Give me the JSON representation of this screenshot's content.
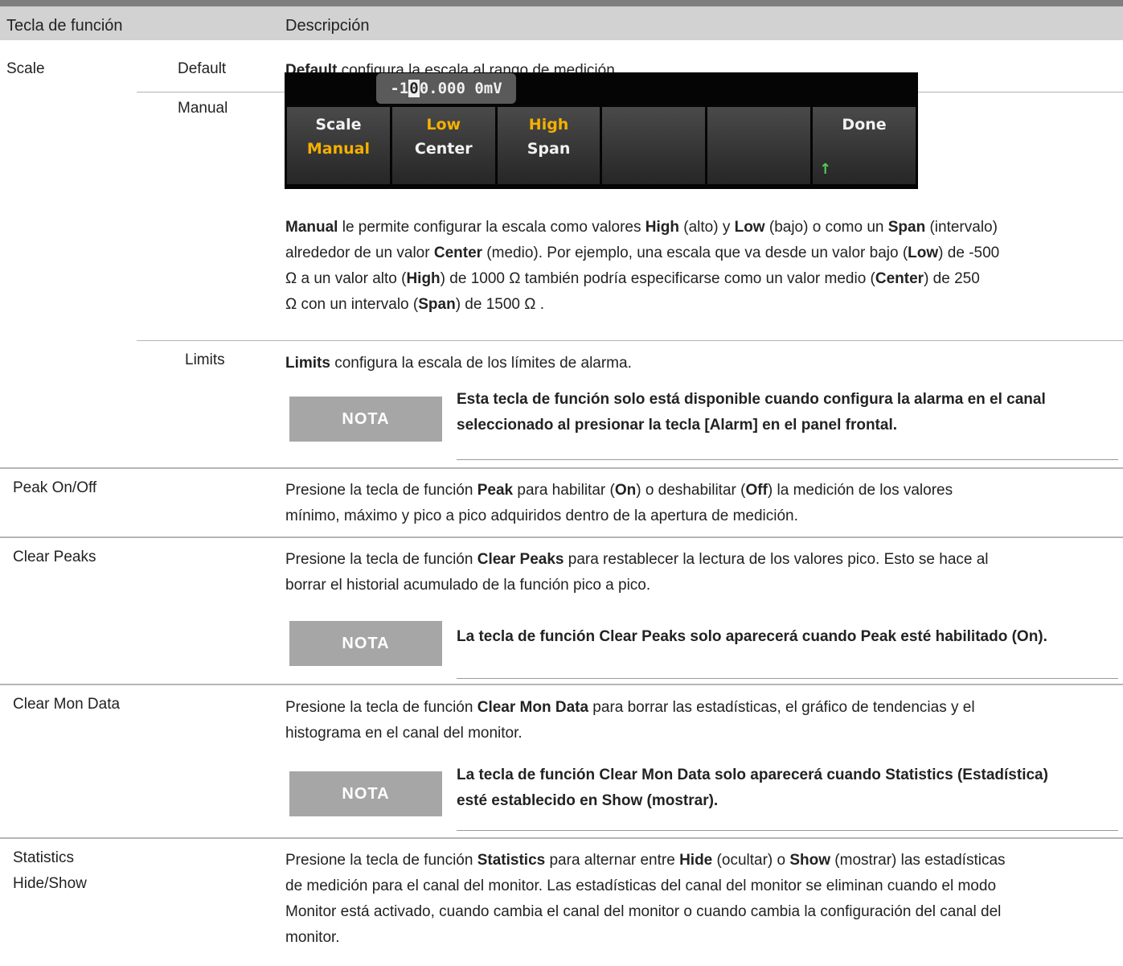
{
  "header": {
    "col1": "Tecla de función",
    "col2": "Descripción"
  },
  "scale": {
    "label": "Scale",
    "default": {
      "label": "Default",
      "bold": "Default",
      "text": " configura la escala al rango de medición."
    },
    "manual": {
      "label": "Manual",
      "screen": {
        "entry_pre": "-1",
        "entry_cursor": "0",
        "entry_post": "0.000 0mV",
        "softkeys": [
          {
            "line1": "Scale",
            "line2": "Manual"
          },
          {
            "line1": "Low",
            "line2": "Center"
          },
          {
            "line1": "High",
            "line2": "Span"
          },
          {
            "line1": "",
            "line2": ""
          },
          {
            "line1": "",
            "line2": ""
          },
          {
            "line1": "Done",
            "line2": "↑"
          }
        ]
      },
      "p": [
        "Manual",
        " le permite configurar la escala como valores ",
        "High",
        " (alto) y ",
        "Low",
        " (bajo) o como un ",
        "Span",
        " (intervalo)",
        "alrededor de un valor ",
        "Center",
        " (medio). Por ejemplo, una escala que va desde un valor bajo (",
        "Low",
        ") de -500",
        "Ω  a un valor alto (",
        "High",
        ") de 1000 Ω  también podría especificarse como un valor medio (",
        "Center",
        ") de 250",
        "Ω  con un intervalo (",
        "Span",
        ") de 1500 Ω ."
      ]
    },
    "limits": {
      "label": "Limits",
      "bold": "Limits",
      "text": " configura la escala de los límites de alarma.",
      "nota": "NOTA",
      "note_l1": "Esta tecla de función solo está disponible cuando configura la alarma en el canal",
      "note_l2": "seleccionado al presionar la tecla [Alarm] en el panel frontal."
    }
  },
  "peak": {
    "label": "Peak On/Off",
    "p": [
      "Presione la tecla de función ",
      "Peak",
      " para habilitar (",
      "On",
      ") o deshabilitar (",
      "Off",
      ") la medición de los valores",
      "mínimo, máximo y pico a pico adquiridos dentro de la apertura de medición."
    ]
  },
  "clear_peaks": {
    "label": "Clear Peaks",
    "p": [
      "Presione la tecla de función ",
      "Clear Peaks",
      " para restablecer la lectura de los valores pico. Esto se hace al",
      "borrar el historial acumulado de la función pico a pico."
    ],
    "nota": "NOTA",
    "note": "La tecla de función Clear Peaks solo aparecerá cuando Peak esté habilitado (On)."
  },
  "clear_mon": {
    "label": "Clear Mon Data",
    "p": [
      "Presione la tecla de función ",
      "Clear Mon Data",
      " para borrar las estadísticas, el gráfico de tendencias y el",
      "histograma en el canal del monitor."
    ],
    "nota": "NOTA",
    "note_l1": "La tecla de función Clear Mon Data solo aparecerá cuando Statistics (Estadística)",
    "note_l2": "esté establecido en Show (mostrar)."
  },
  "statistics": {
    "label_l1": "Statistics",
    "label_l2": "Hide/Show",
    "p": [
      "Presione la tecla de función ",
      "Statistics",
      " para alternar entre ",
      "Hide",
      " (ocultar) o ",
      "Show",
      " (mostrar) las estadísticas",
      "de medición para el canal del monitor. Las estadísticas del canal del monitor se eliminan cuando el modo",
      "Monitor está activado, cuando cambia el canal del monitor o cuando cambia la configuración del canal del",
      "monitor."
    ]
  }
}
